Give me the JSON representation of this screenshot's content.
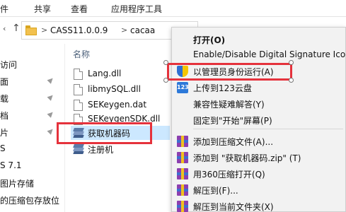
{
  "ribbon": {
    "tabs": [
      "件",
      "共享",
      "查看",
      "应用程序工具"
    ]
  },
  "address": {
    "crumbs": [
      "CASS11.0.0.9",
      "cacaa"
    ],
    "separator": ">"
  },
  "nav": {
    "items": [
      "访问",
      "面",
      "载",
      "档",
      "片",
      "S",
      "S 7.1",
      "图片存储",
      "的压缩包存放位"
    ]
  },
  "file_list": {
    "column_header": "名称",
    "files": [
      {
        "name": "Lang.dll",
        "type": "dll"
      },
      {
        "name": "libmySQL.dll",
        "type": "dll"
      },
      {
        "name": "SEKeygen.dat",
        "type": "dat"
      },
      {
        "name": "SEKeygenSDK.dll",
        "type": "dll"
      },
      {
        "name": "获取机器码",
        "type": "exe",
        "selected": true
      },
      {
        "name": "注册机",
        "type": "exe"
      }
    ]
  },
  "context_menu": {
    "items": [
      {
        "label": "打开(O)",
        "bold": true,
        "icon": ""
      },
      {
        "label": "Enable/Disable Digital Signature Icons",
        "icon": ""
      },
      {
        "label": "以管理员身份运行(A)",
        "icon": "uac-shield-icon",
        "highlighted": true
      },
      {
        "label": "上传到123云盘",
        "icon": "123-cloud-icon"
      },
      {
        "label": "兼容性疑难解答(Y)",
        "icon": ""
      },
      {
        "label": "固定到\"开始\"屏幕(P)",
        "icon": ""
      },
      {
        "label": "添加到压缩文件(A)...",
        "icon": "winrar-icon"
      },
      {
        "label": "添加到 \"获取机器码.zip\" (T)",
        "icon": "winrar-icon"
      },
      {
        "label": "用360压缩打开(Q)",
        "icon": "winrar-icon"
      },
      {
        "label": "解压到(F)...",
        "icon": "winrar-icon"
      },
      {
        "label": "解压到当前文件夹(X)",
        "icon": "winrar-icon"
      }
    ],
    "icon_text_123": "123"
  },
  "colors": {
    "highlight_red": "#e5323c",
    "selection_blue": "#cce8ff",
    "menu_bg": "#f2f2f2"
  }
}
